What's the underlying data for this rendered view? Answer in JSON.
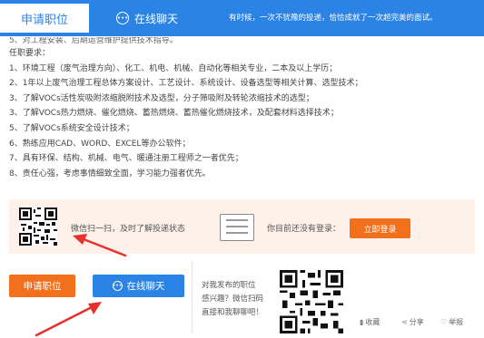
{
  "topbar": {
    "apply_tab": "申请职位",
    "chat_tab": "在线聊天",
    "chat_icon": "chat-bubble-icon",
    "slogan": "有时候，一次不犹豫的投递，恰恰成就了一次超完美的面试。"
  },
  "requirements": {
    "lines": [
      "5、对工程安装、后期运营维护提供技术指导。",
      "任职要求：",
      "1、环境工程（废气治理方向）、化工、机电、机械、自动化等相关专业，二本及以上学历；",
      "2、1年以上废气治理工程总体方案设计、工艺设计、系统设计、设备选型等相关计算、选型技术；",
      "3、了解VOCs活性炭吸附浓缩脱附技术及选型，分子筛吸附及转轮浓缩技术的选型；",
      "3、了解VOCs热力燃烧、催化燃烧、蓄热燃烧、蓄热催化燃烧技术，及配套材料选择技术；",
      "5、了解VOCs系统安全设计技术；",
      "6、熟练应用CAD、WORD、EXCEL等办公软件；",
      "7、具有环保、结构、机械、电气、暖通注册工程师之一者优先；",
      "8、责任心强，考虑事情细致全面，学习能力强者优先。"
    ]
  },
  "scan": {
    "text": "微信扫一扫，及时了解投递状态",
    "login_question": "你目前还没有登录：",
    "login_button": "立即登录"
  },
  "bottom": {
    "apply_button": "申请职位",
    "chat_button": "在线聊天",
    "promo_lines": [
      "对我发布的职位",
      "感兴趣？微信扫码",
      "直接和我聊聊吧！"
    ],
    "favorite": "收藏",
    "share": "分享",
    "report": "举报"
  },
  "colors": {
    "brand_blue": "#2b83e6",
    "accent_orange": "#f26f1c",
    "scan_bg": "#fdf1ea",
    "annotation_red": "#e8312f"
  }
}
